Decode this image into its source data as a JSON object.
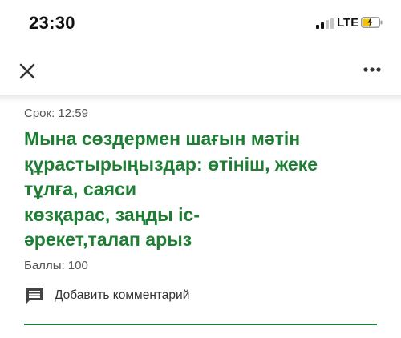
{
  "status_bar": {
    "time": "23:30",
    "network": "LTE",
    "signal_bars_active": 2,
    "battery_charging": true
  },
  "app_bar": {
    "close_icon": "close-icon",
    "more_icon": "more-horizontal-icon"
  },
  "assignment": {
    "deadline": "Срок: 12:59",
    "title": "Мына сөздермен шағын мәтін\nқұрастырыңыздар: өтініш, жеке\nтұлға, саяси\nкөзқарас, заңды іс-\nәрекет,талап арыз",
    "points": "Баллы: 100"
  },
  "comment": {
    "icon": "comment-icon",
    "label": "Добавить комментарий"
  },
  "colors": {
    "accent": "#1e7e34",
    "battery": "#f5c400",
    "secondary_text": "#555555"
  }
}
